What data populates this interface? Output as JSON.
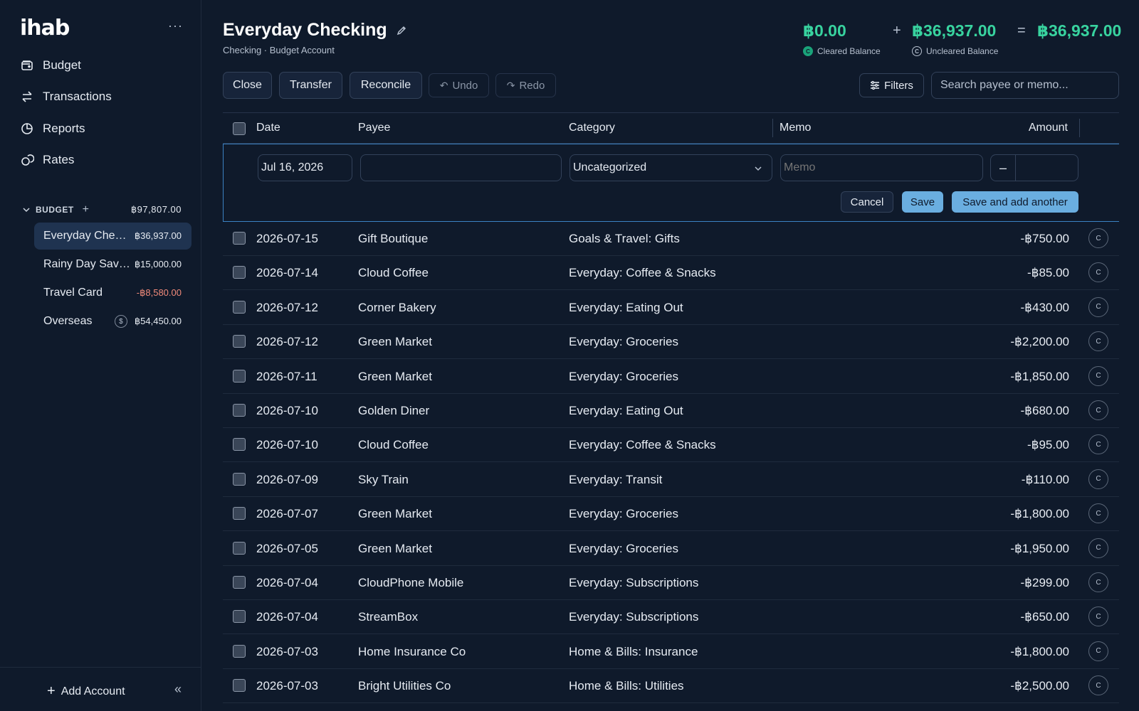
{
  "sidebar": {
    "logo": "ihab",
    "nav": [
      {
        "label": "Budget",
        "icon": "wallet-icon"
      },
      {
        "label": "Transactions",
        "icon": "arrows-swap-icon"
      },
      {
        "label": "Reports",
        "icon": "pie-chart-icon"
      },
      {
        "label": "Rates",
        "icon": "coins-icon"
      }
    ],
    "budget_group": {
      "label": "BUDGET",
      "total": "฿97,807.00"
    },
    "accounts": [
      {
        "name": "Everyday Checking",
        "balance": "฿36,937.00",
        "negative": false,
        "active": true
      },
      {
        "name": "Rainy Day Savings",
        "balance": "฿15,000.00",
        "negative": false,
        "active": false
      },
      {
        "name": "Travel Card",
        "balance": "-฿8,580.00",
        "negative": true,
        "active": false
      },
      {
        "name": "Overseas",
        "balance": "฿54,450.00",
        "negative": false,
        "active": false,
        "currency_badge": "$"
      }
    ],
    "add_account": "Add Account"
  },
  "header": {
    "title": "Everyday Checking",
    "subtitle": "Checking · Budget Account",
    "cleared": {
      "amount": "฿0.00",
      "label": "Cleared Balance"
    },
    "uncleared": {
      "amount": "฿36,937.00",
      "label": "Uncleared Balance"
    },
    "total": "฿36,937.00",
    "plus": "+",
    "equals": "="
  },
  "toolbar": {
    "close": "Close",
    "transfer": "Transfer",
    "reconcile": "Reconcile",
    "undo": "Undo",
    "redo": "Redo",
    "filters": "Filters",
    "search_placeholder": "Search payee or memo..."
  },
  "columns": {
    "date": "Date",
    "payee": "Payee",
    "category": "Category",
    "memo": "Memo",
    "amount": "Amount"
  },
  "new_txn": {
    "date": "Jul 16, 2026",
    "payee": "",
    "category": "Uncategorized",
    "memo_placeholder": "Memo",
    "minus": "–",
    "cancel": "Cancel",
    "save": "Save",
    "save_another": "Save and add another"
  },
  "transactions": [
    {
      "date": "2026-07-15",
      "payee": "Gift Boutique",
      "category": "Goals & Travel: Gifts",
      "amount": "-฿750.00"
    },
    {
      "date": "2026-07-14",
      "payee": "Cloud Coffee",
      "category": "Everyday: Coffee & Snacks",
      "amount": "-฿85.00"
    },
    {
      "date": "2026-07-12",
      "payee": "Corner Bakery",
      "category": "Everyday: Eating Out",
      "amount": "-฿430.00"
    },
    {
      "date": "2026-07-12",
      "payee": "Green Market",
      "category": "Everyday: Groceries",
      "amount": "-฿2,200.00"
    },
    {
      "date": "2026-07-11",
      "payee": "Green Market",
      "category": "Everyday: Groceries",
      "amount": "-฿1,850.00"
    },
    {
      "date": "2026-07-10",
      "payee": "Golden Diner",
      "category": "Everyday: Eating Out",
      "amount": "-฿680.00"
    },
    {
      "date": "2026-07-10",
      "payee": "Cloud Coffee",
      "category": "Everyday: Coffee & Snacks",
      "amount": "-฿95.00"
    },
    {
      "date": "2026-07-09",
      "payee": "Sky Train",
      "category": "Everyday: Transit",
      "amount": "-฿110.00"
    },
    {
      "date": "2026-07-07",
      "payee": "Green Market",
      "category": "Everyday: Groceries",
      "amount": "-฿1,800.00"
    },
    {
      "date": "2026-07-05",
      "payee": "Green Market",
      "category": "Everyday: Groceries",
      "amount": "-฿1,950.00"
    },
    {
      "date": "2026-07-04",
      "payee": "CloudPhone Mobile",
      "category": "Everyday: Subscriptions",
      "amount": "-฿299.00"
    },
    {
      "date": "2026-07-04",
      "payee": "StreamBox",
      "category": "Everyday: Subscriptions",
      "amount": "-฿650.00"
    },
    {
      "date": "2026-07-03",
      "payee": "Home Insurance Co",
      "category": "Home & Bills: Insurance",
      "amount": "-฿1,800.00"
    },
    {
      "date": "2026-07-03",
      "payee": "Bright Utilities Co",
      "category": "Home & Bills: Utilities",
      "amount": "-฿2,500.00"
    }
  ],
  "cleared_badge": "C",
  "colors": {
    "accent_green": "#38d39f",
    "primary_blue": "#6aaee0",
    "negative": "#f08a7a",
    "bg": "#0f1a2b"
  }
}
